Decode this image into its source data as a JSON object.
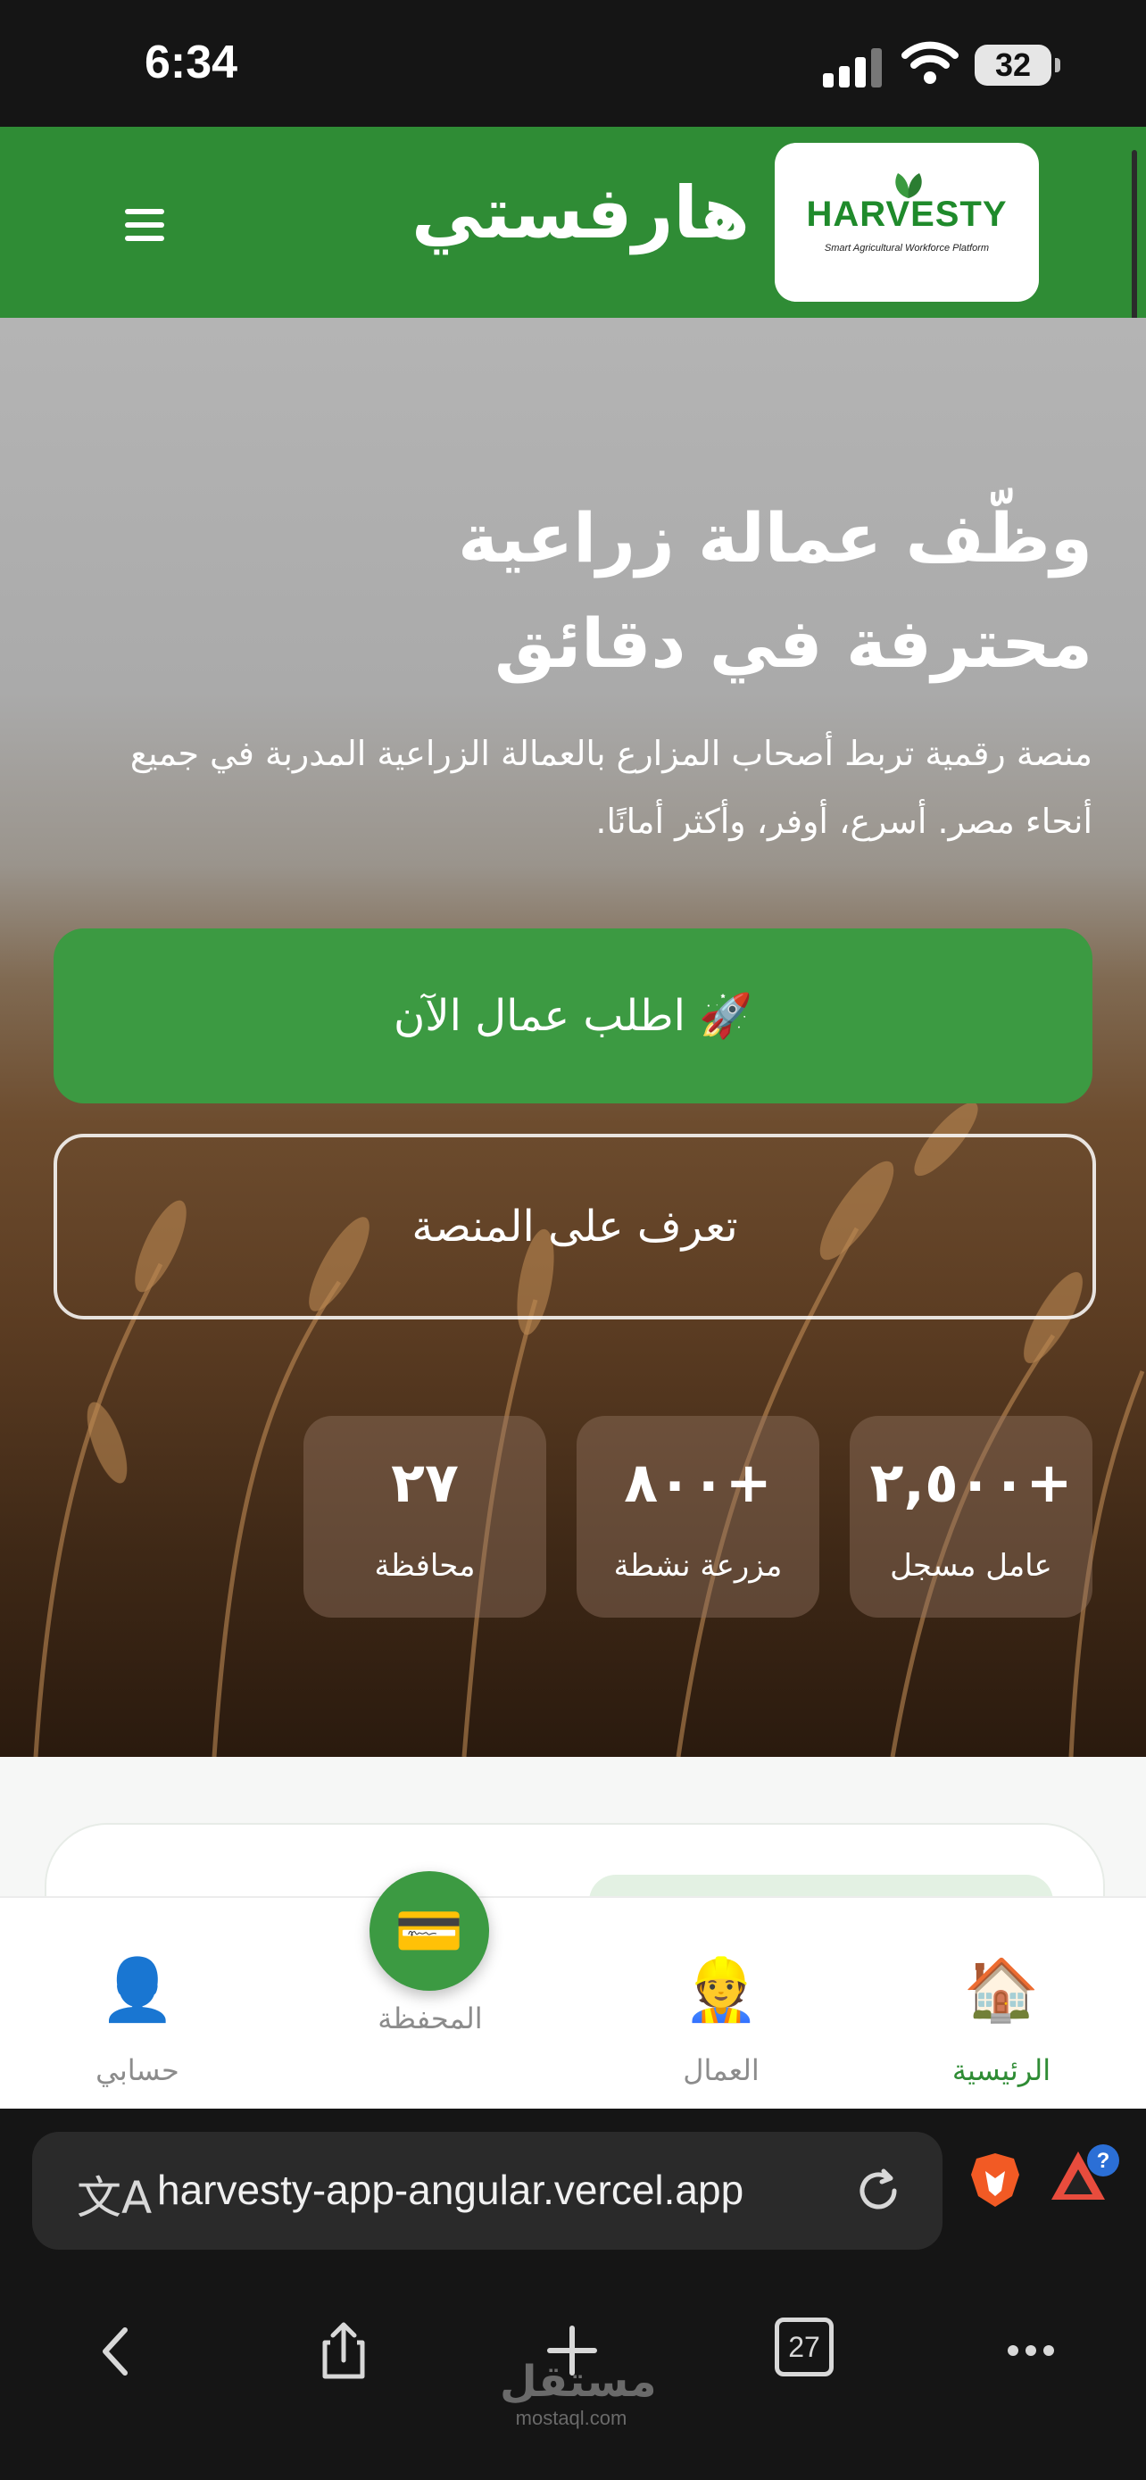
{
  "status_bar": {
    "time": "6:34",
    "battery": "32"
  },
  "header": {
    "brand_title": "هارفستي",
    "logo_text": "HARVESTY",
    "logo_tagline": "Smart Agricultural Workforce Platform"
  },
  "hero": {
    "title_line1": "وظّف عمالة زراعية",
    "title_line2": "محترفة في دقائق",
    "description": "منصة رقمية تربط أصحاب المزارع بالعمالة الزراعية المدربة في جميع أنحاء مصر. أسرع، أوفر، وأكثر أمانًا.",
    "primary_button": "🚀 اطلب عمال الآن",
    "secondary_button": "تعرف على المنصة",
    "stats": [
      {
        "value": "+٢,٥٠٠",
        "label": "عامل مسجل"
      },
      {
        "value": "+٨٠٠",
        "label": "مزرعة نشطة"
      },
      {
        "value": "٢٧",
        "label": "محافظة"
      }
    ]
  },
  "bottom_nav": {
    "items": [
      {
        "label": "الرئيسية",
        "icon": "🏠",
        "icon_name": "home-icon",
        "active": true
      },
      {
        "label": "العمال",
        "icon": "👷",
        "icon_name": "worker-icon",
        "active": false
      },
      {
        "label": "المحفظة",
        "icon": "💳",
        "icon_name": "wallet-icon",
        "active": false
      },
      {
        "label": "حسابي",
        "icon": "👤",
        "icon_name": "profile-icon",
        "active": false
      }
    ]
  },
  "browser": {
    "url": "harvesty-app-angular.vercel.app",
    "tabs_count": "27",
    "rewards_badge": "?"
  },
  "watermark": {
    "arabic": "مستقل",
    "latin": "mostaql.com"
  },
  "colors": {
    "brand_green": "#2f8c35",
    "button_green": "#3c9a42",
    "nav_active": "#2f8c35",
    "nav_inactive": "#8c8c8c"
  }
}
